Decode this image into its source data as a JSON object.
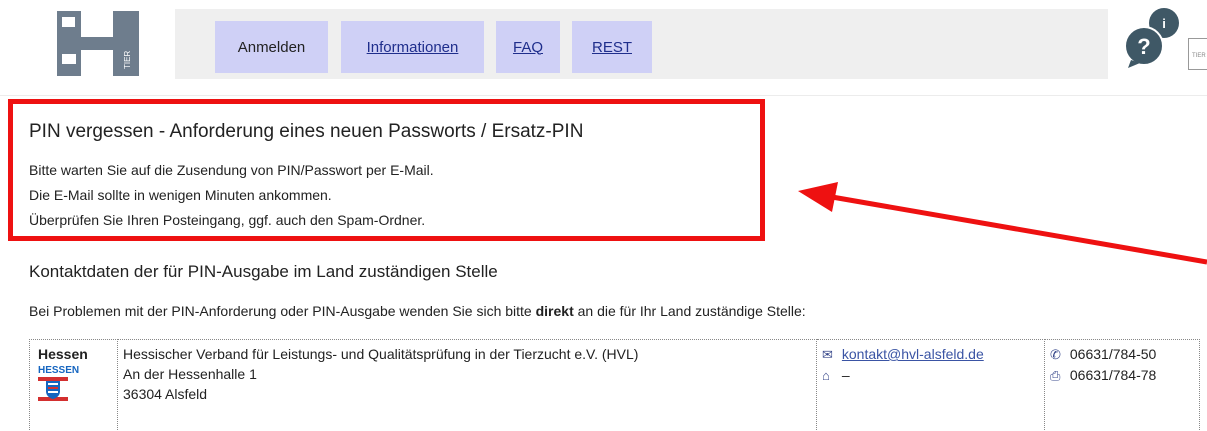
{
  "nav": {
    "items": [
      {
        "label": "Anmelden",
        "link": false
      },
      {
        "label": "Informationen",
        "link": true
      },
      {
        "label": "FAQ",
        "link": true
      },
      {
        "label": "REST",
        "link": true
      }
    ]
  },
  "logo": {
    "text": "TIER"
  },
  "help": {
    "icon": "question-info-icon",
    "cut_text": "TIER"
  },
  "notice": {
    "title": "PIN vergessen - Anforderung eines neuen Passworts / Ersatz-PIN",
    "lines": [
      "Bitte warten Sie auf die Zusendung von PIN/Passwort per E-Mail.",
      "Die E-Mail sollte in wenigen Minuten ankommen.",
      "Überprüfen Sie Ihren Posteingang, ggf. auch den Spam-Ordner."
    ]
  },
  "contact": {
    "title": "Kontaktdaten der für PIN-Ausgabe im Land zuständigen Stelle",
    "intro_before": "Bei Problemen mit der PIN-Anforderung oder PIN-Ausgabe wenden Sie sich bitte ",
    "intro_bold": "direkt",
    "intro_after": " an die für Ihr Land zuständige Stelle:",
    "row": {
      "state": "Hessen",
      "flag_label": "HESSEN",
      "org": "Hessischer Verband für Leistungs- und Qualitätsprüfung in der Tierzucht e.V. (HVL)",
      "street": "An der Hessenhalle 1",
      "city": "36304 Alsfeld",
      "email": "kontakt@hvl-alsfeld.de",
      "home": "–",
      "phone": "06631/784-50",
      "fax": "06631/784-78"
    }
  },
  "colors": {
    "nav_bg": "#cfd0f6",
    "highlight": "#ee1111",
    "link": "#3a54a4"
  }
}
